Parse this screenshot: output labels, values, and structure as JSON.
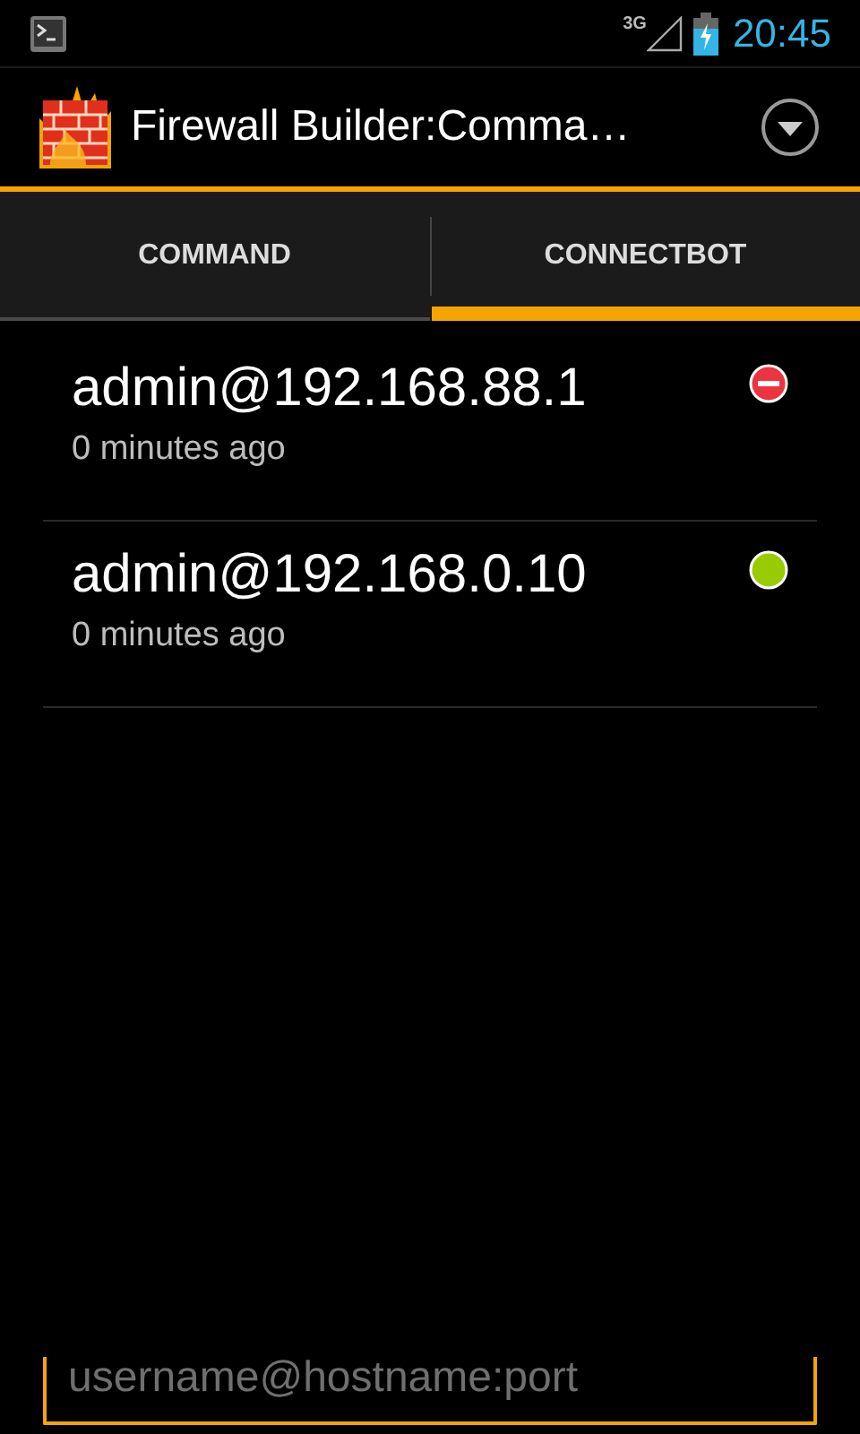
{
  "status_bar": {
    "network": "3G",
    "time": "20:45"
  },
  "action_bar": {
    "title": "Firewall Builder:Comma…"
  },
  "tabs": [
    {
      "label": "COMMAND",
      "selected": false
    },
    {
      "label": "CONNECTBOT",
      "selected": true
    }
  ],
  "hosts": [
    {
      "name": "admin@192.168.88.1",
      "time": "0 minutes ago",
      "connected": false
    },
    {
      "name": "admin@192.168.0.10",
      "time": "0 minutes ago",
      "connected": true
    }
  ],
  "input": {
    "placeholder": "username@hostname:port"
  }
}
